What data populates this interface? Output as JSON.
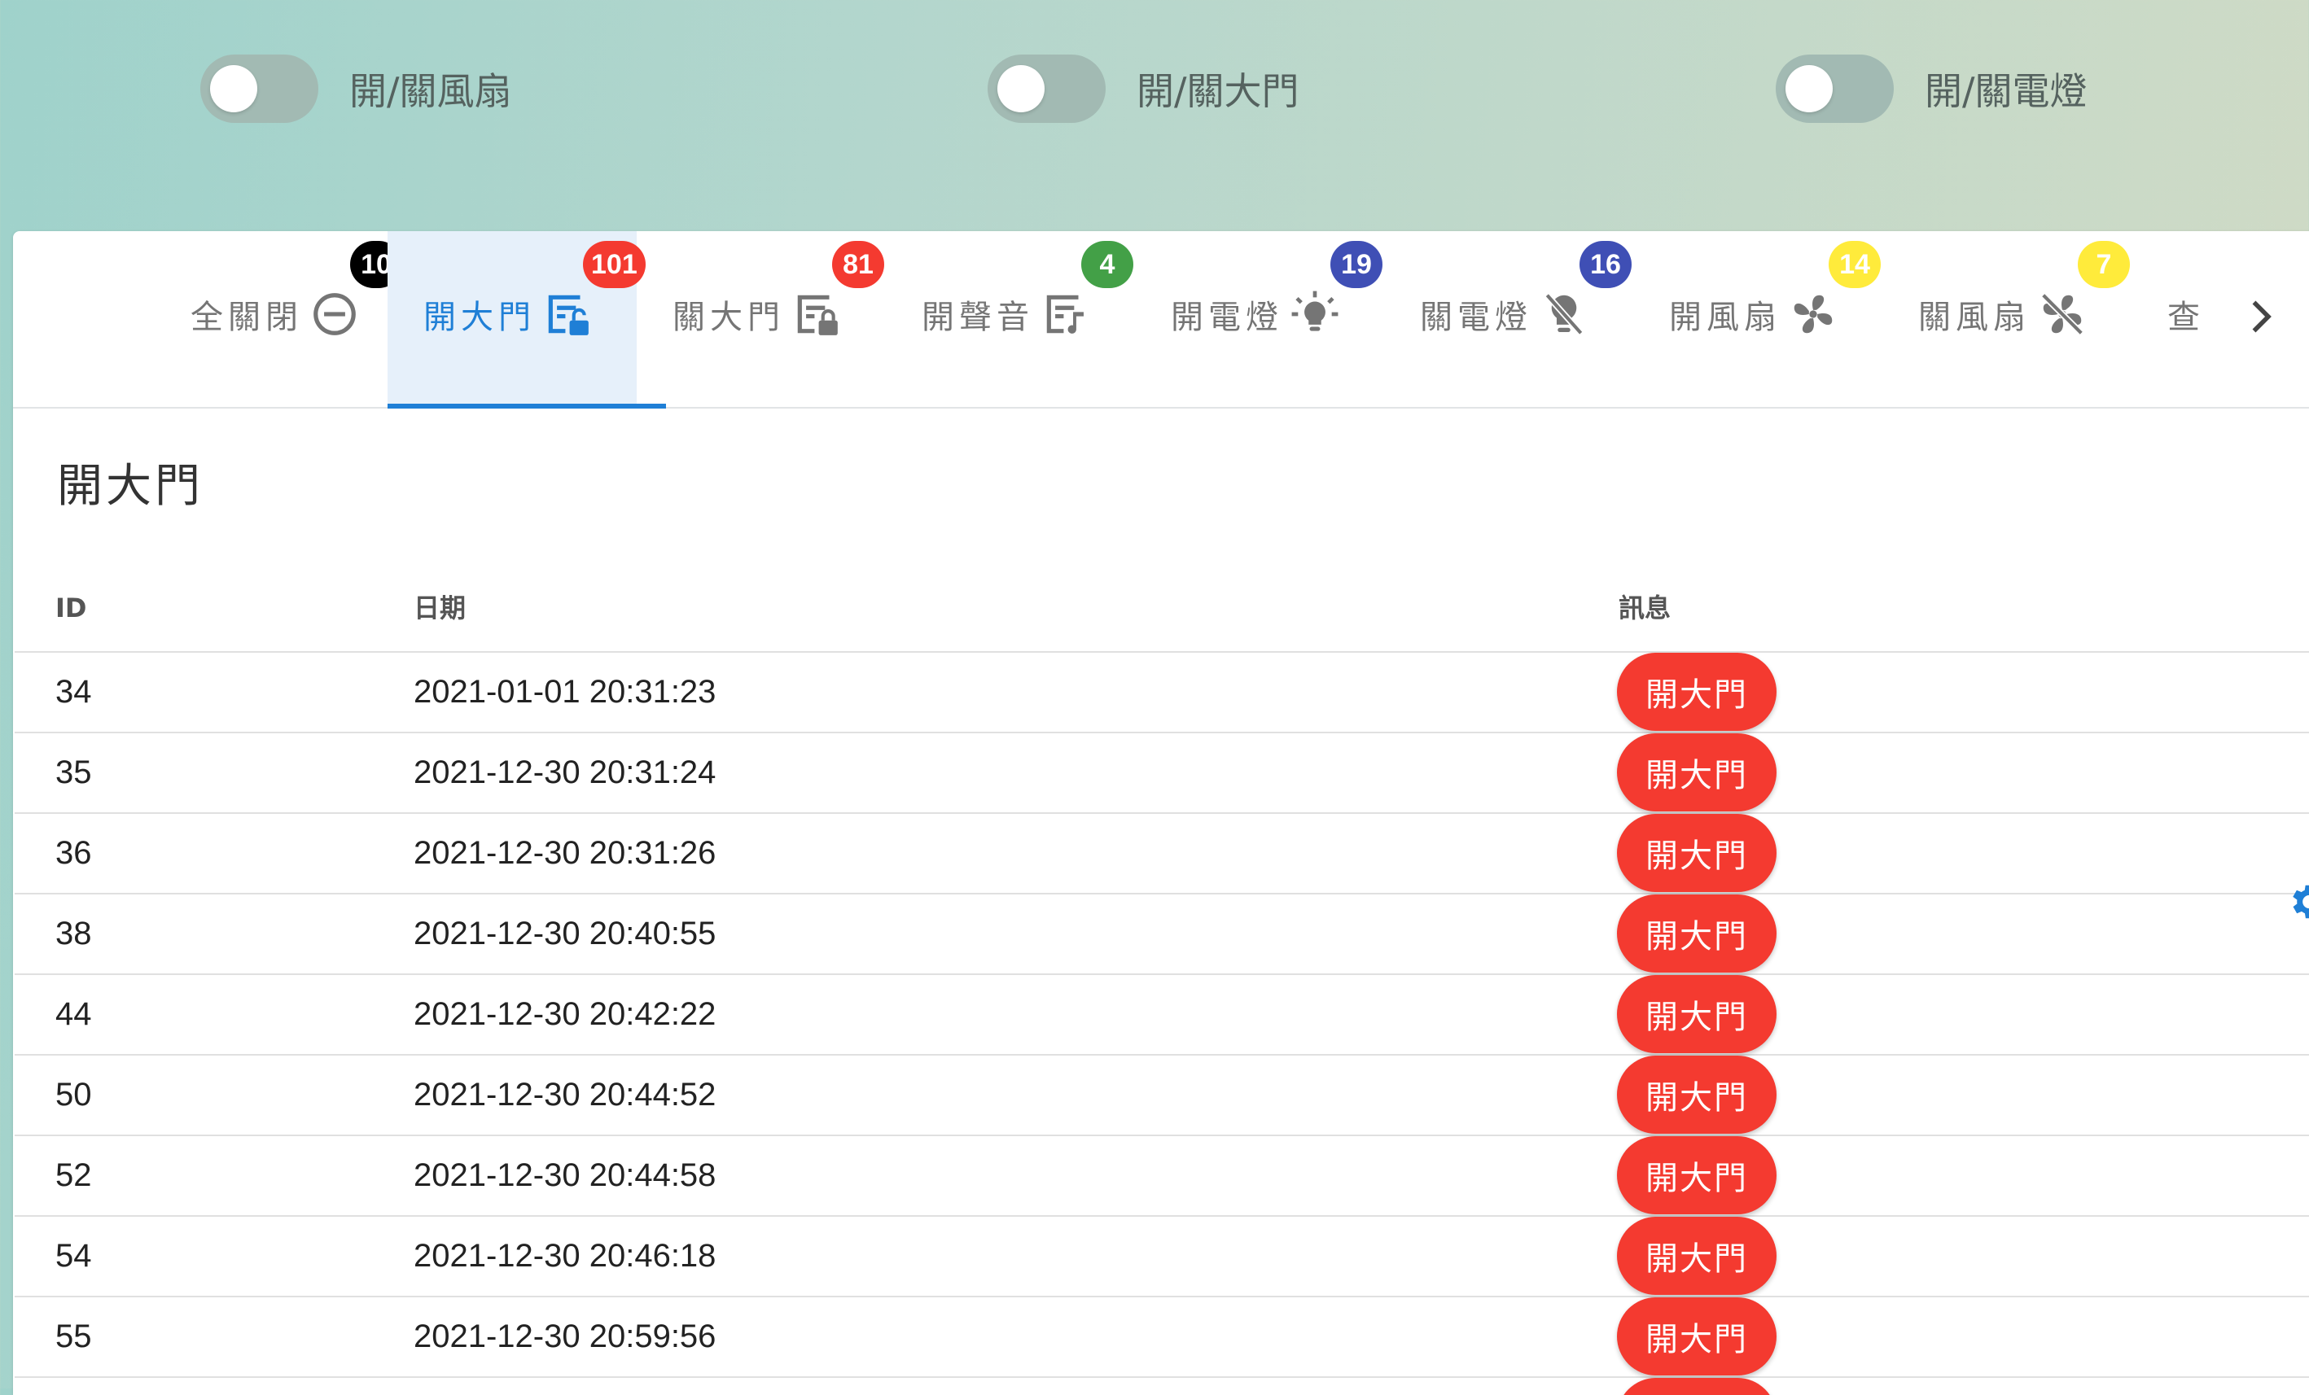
{
  "toggles": [
    {
      "label": "開/關風扇",
      "state": "off"
    },
    {
      "label": "開/關大門",
      "state": "off"
    },
    {
      "label": "開/關電燈",
      "state": "off"
    }
  ],
  "tabs": [
    {
      "label": "全關閉",
      "icon": "minus-circle-icon",
      "badge": "10",
      "badge_color": "#000000",
      "active": false
    },
    {
      "label": "開大門",
      "icon": "door-unlocked-icon",
      "badge": "101",
      "badge_color": "#f43a30",
      "active": true
    },
    {
      "label": "關大門",
      "icon": "door-locked-icon",
      "badge": "81",
      "badge_color": "#f43a30",
      "active": false
    },
    {
      "label": "開聲音",
      "icon": "door-music-icon",
      "badge": "4",
      "badge_color": "#43a047",
      "active": false
    },
    {
      "label": "開電燈",
      "icon": "lightbulb-on-icon",
      "badge": "19",
      "badge_color": "#3f4fb5",
      "active": false
    },
    {
      "label": "關電燈",
      "icon": "lightbulb-off-icon",
      "badge": "16",
      "badge_color": "#3f4fb5",
      "active": false
    },
    {
      "label": "開風扇",
      "icon": "fan-icon",
      "badge": "14",
      "badge_color": "#ffeb3b",
      "active": false
    },
    {
      "label": "關風扇",
      "icon": "fan-off-icon",
      "badge": "7",
      "badge_color": "#ffeb3b",
      "active": false
    },
    {
      "label": "查",
      "icon": "",
      "badge": "",
      "badge_color": "",
      "active": false
    }
  ],
  "section": {
    "title": "開大門"
  },
  "table": {
    "columns": [
      "ID",
      "日期",
      "訊息"
    ],
    "rows": [
      {
        "id": "34",
        "date": "2021-01-01 20:31:23",
        "message": "開大門"
      },
      {
        "id": "35",
        "date": "2021-12-30 20:31:24",
        "message": "開大門"
      },
      {
        "id": "36",
        "date": "2021-12-30 20:31:26",
        "message": "開大門"
      },
      {
        "id": "38",
        "date": "2021-12-30 20:40:55",
        "message": "開大門"
      },
      {
        "id": "44",
        "date": "2021-12-30 20:42:22",
        "message": "開大門"
      },
      {
        "id": "50",
        "date": "2021-12-30 20:44:52",
        "message": "開大門"
      },
      {
        "id": "52",
        "date": "2021-12-30 20:44:58",
        "message": "開大門"
      },
      {
        "id": "54",
        "date": "2021-12-30 20:46:18",
        "message": "開大門"
      },
      {
        "id": "55",
        "date": "2021-12-30 20:59:56",
        "message": "開大門"
      },
      {
        "id": "",
        "date": "",
        "message": ""
      }
    ]
  },
  "colors": {
    "accent": "#1f7fd6",
    "chip": "#f43a30",
    "tab_active_bg": "#e6f0fa"
  }
}
